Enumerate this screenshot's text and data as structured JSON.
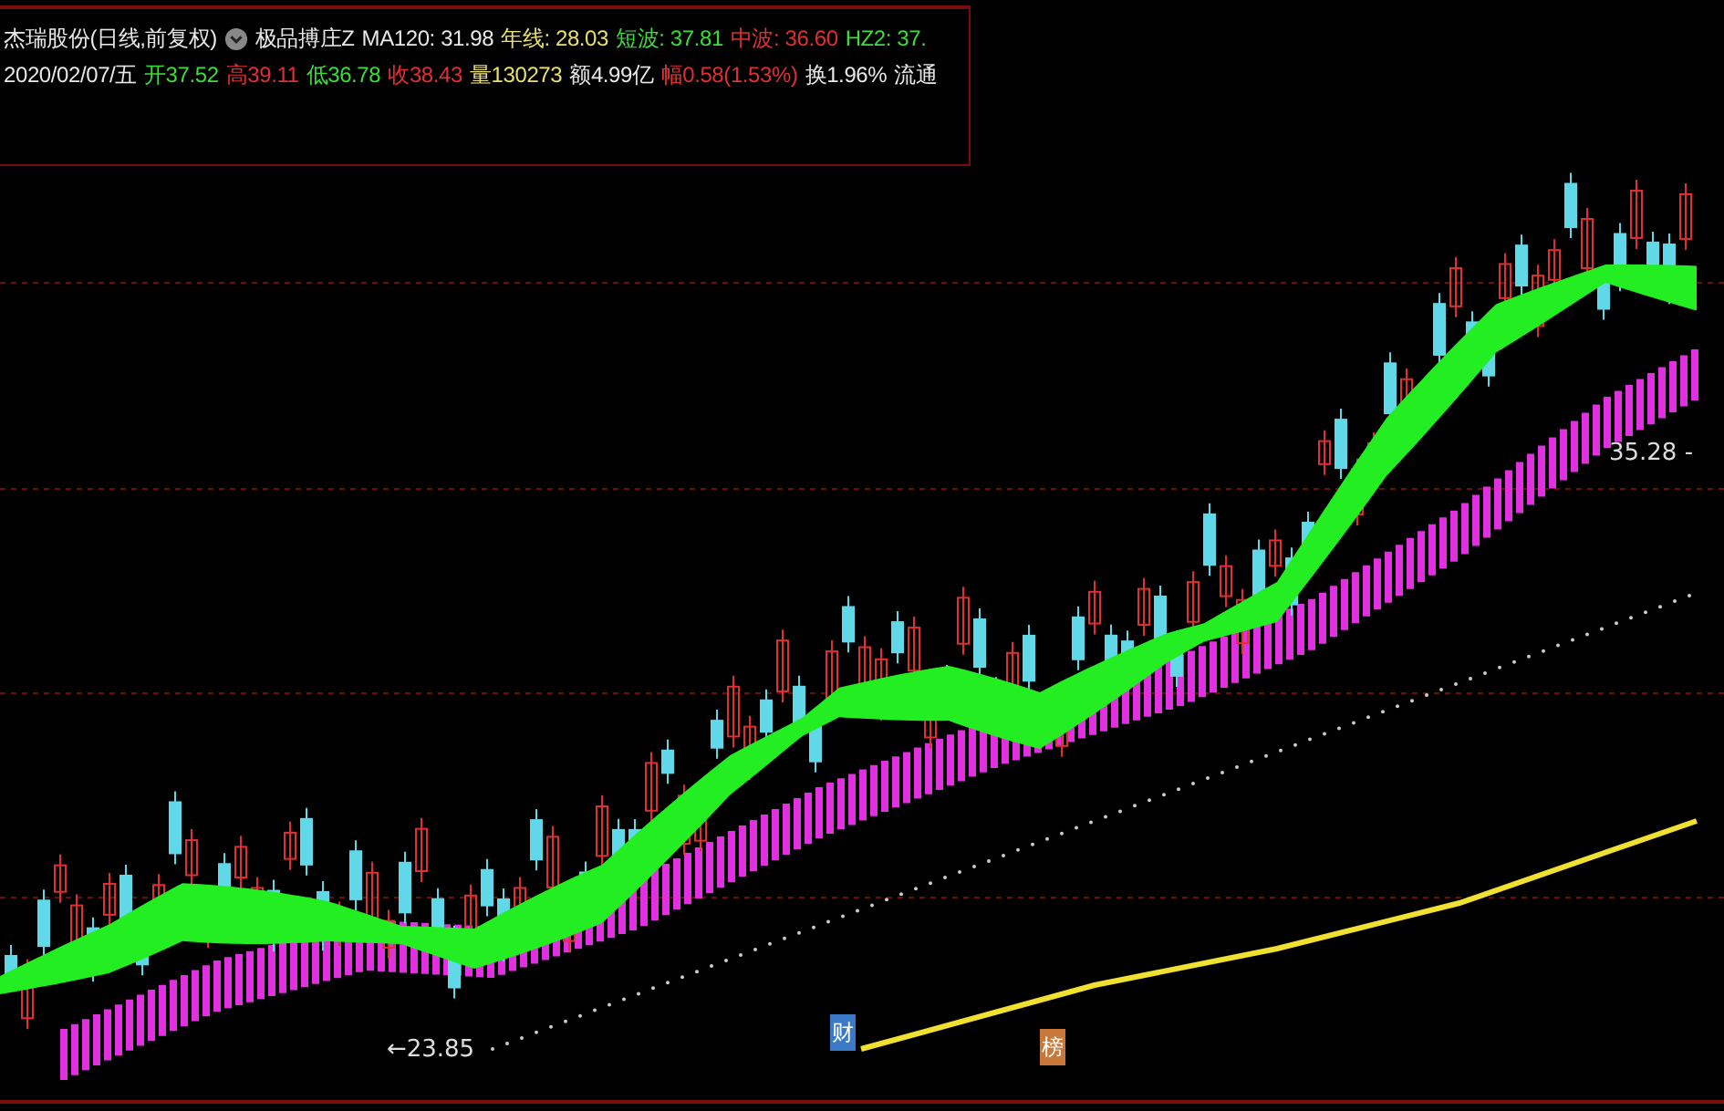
{
  "header": {
    "stock": "杰瑞股份(日线,前复权)",
    "indicator": "极品搏庄Z",
    "indicator_values": [
      {
        "text": "MA120: 31.98",
        "color": "#e8e8e8"
      },
      {
        "text": "年线: 28.03",
        "color": "#e8e070"
      },
      {
        "text": "短波: 37.81",
        "color": "#3cdc3c"
      },
      {
        "text": "中波: 36.60",
        "color": "#e03030"
      },
      {
        "text": "HZ2: 37.",
        "color": "#3cdc3c"
      }
    ],
    "date": "2020/02/07/五",
    "quotes": [
      {
        "text": "开37.52",
        "color": "#3cdc3c"
      },
      {
        "text": "高39.11",
        "color": "#e03030"
      },
      {
        "text": "低36.78",
        "color": "#3cdc3c"
      },
      {
        "text": "收38.43",
        "color": "#e03030"
      },
      {
        "text": "量130273",
        "color": "#e8e070"
      },
      {
        "text": "额4.99亿",
        "color": "#e8e8e8"
      },
      {
        "text": "幅0.58(1.53%)",
        "color": "#e03030"
      },
      {
        "text": "换1.96%",
        "color": "#e8e8e8"
      },
      {
        "text": "流通",
        "color": "#e8e8e8"
      }
    ]
  },
  "chart": {
    "high_label": "35.28 -",
    "low_label": "←23.85",
    "markers": [
      {
        "text": "财",
        "color": "#3a78c8"
      },
      {
        "text": "榜",
        "color": "#c87838"
      }
    ]
  }
}
